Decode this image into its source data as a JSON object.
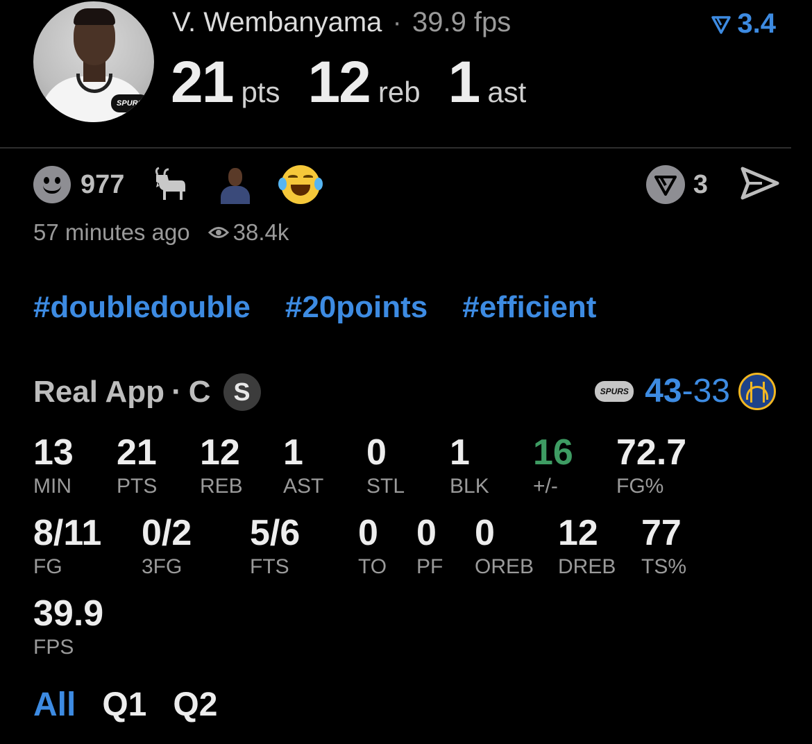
{
  "header": {
    "player_name": "V. Wembanyama",
    "separator": "·",
    "fps_text": "39.9 fps",
    "rating_value": "3.4",
    "avatar_badge": "SPURS",
    "headline": [
      {
        "value": "21",
        "label": "pts"
      },
      {
        "value": "12",
        "label": "reb"
      },
      {
        "value": "1",
        "label": "ast"
      }
    ]
  },
  "reactions": {
    "count": "977",
    "emojis": [
      "goat-icon",
      "player-face-icon",
      "laughing-emoji-icon"
    ]
  },
  "actions": {
    "comment_count": "3"
  },
  "meta": {
    "time_ago": "57 minutes ago",
    "views": "38.4k"
  },
  "tags": [
    "#doubledouble",
    "#20points",
    "#efficient"
  ],
  "game": {
    "source": "Real App",
    "separator": "·",
    "position": "C",
    "badge": "S",
    "team_logo_text": "SPURS",
    "team_score": "43",
    "dash": "-",
    "opponent_score": "33"
  },
  "stats": {
    "row1": [
      {
        "value": "13",
        "key": "MIN"
      },
      {
        "value": "21",
        "key": "PTS"
      },
      {
        "value": "12",
        "key": "REB"
      },
      {
        "value": "1",
        "key": "AST"
      },
      {
        "value": "0",
        "key": "STL"
      },
      {
        "value": "1",
        "key": "BLK"
      },
      {
        "value": "16",
        "key": "+/-"
      },
      {
        "value": "72.7",
        "key": "FG%"
      }
    ],
    "row2": [
      {
        "value": "8/11",
        "key": "FG"
      },
      {
        "value": "0/2",
        "key": "3FG"
      },
      {
        "value": "5/6",
        "key": "FTS"
      },
      {
        "value": "0",
        "key": "TO"
      },
      {
        "value": "0",
        "key": "PF"
      },
      {
        "value": "0",
        "key": "OREB"
      },
      {
        "value": "12",
        "key": "DREB"
      },
      {
        "value": "77",
        "key": "TS%"
      }
    ],
    "row3": [
      {
        "value": "39.9",
        "key": "FPS"
      }
    ]
  },
  "tabs": [
    {
      "label": "All",
      "active": true
    },
    {
      "label": "Q1",
      "active": false
    },
    {
      "label": "Q2",
      "active": false
    }
  ],
  "colors": {
    "accent": "#3d8be2",
    "positive": "#3e9c63",
    "background": "#000000"
  }
}
